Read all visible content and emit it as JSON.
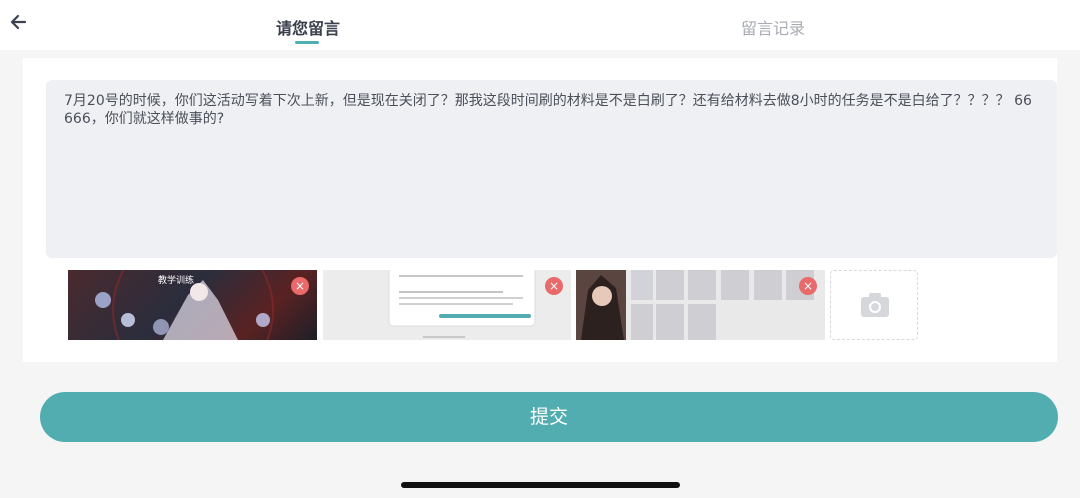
{
  "header": {
    "tabs": [
      {
        "label": "请您留言",
        "active": true
      },
      {
        "label": "留言记录",
        "active": false
      }
    ]
  },
  "message": {
    "text": "7月20号的时候，你们这活动写着下次上新，但是现在关闭了？那我这段时间刷的材料是不是白刷了？还有给材料去做8小时的任务是不是白给了？？？？ 66666，你们就这样做事的?"
  },
  "attachments": {
    "thumb1_caption": "教学训练",
    "remove_label": "×"
  },
  "submit": {
    "label": "提交"
  },
  "colors": {
    "accent": "#52adb1",
    "remove": "#e86a6a",
    "input_bg": "#eff0f3"
  }
}
